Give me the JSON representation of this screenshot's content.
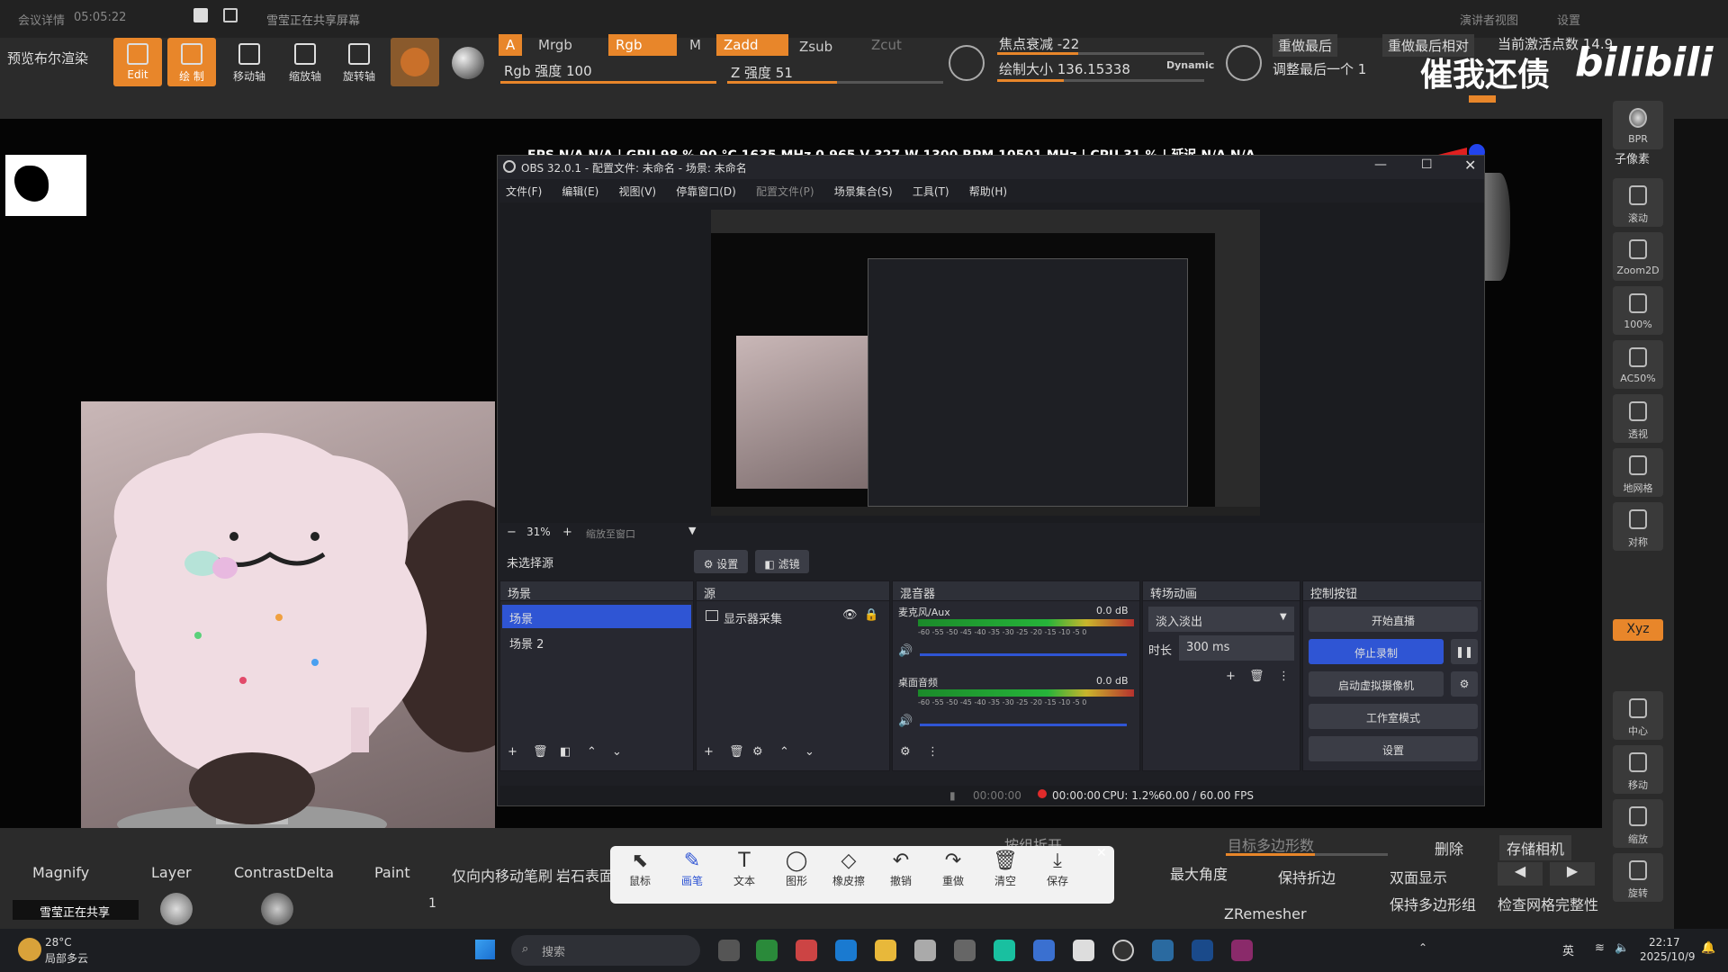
{
  "meeting": {
    "title": "会议详情",
    "time": "05:05:22",
    "sharing": "雪莹正在共享屏幕"
  },
  "meeting_right": {
    "presenter": "演讲者视图",
    "settings": "设置"
  },
  "zbrush": {
    "left_label": "预览布尔渲染",
    "tools": [
      "Edit",
      "绘 制",
      "移动轴",
      "缩放轴",
      "旋转轴"
    ],
    "channels": [
      "A",
      "Mrgb",
      "Rgb",
      "M",
      "Zadd",
      "Zsub",
      "Zcut"
    ],
    "rgb_intensity": "Rgb 强度 100",
    "z_intensity": "Z 强度 51",
    "focal": "焦点衰减 -22",
    "draw_size": "绘制大小 136.15338",
    "dynamic": "Dynamic",
    "redo_last": "重做最后",
    "redo_relative": "重做最后相对",
    "adjust_last": "调整最后一个 1",
    "active_points": "当前激活点数 14.9",
    "watermark": "催我还债",
    "right_tray": [
      "BPR",
      "子像素",
      "滚动",
      "Zoom2D",
      "100%",
      "AC50%",
      "透视",
      "地网格",
      "对称",
      "Xyz",
      "中心",
      "移动",
      "缩放",
      "旋转"
    ],
    "bottom_brushes": [
      "Magnify",
      "Layer",
      "ContrastDelta",
      "Paint",
      "仅向内移动笔刷",
      "岩石表面"
    ],
    "bottom_count": "1",
    "bottom_right": {
      "keep_creases": "保持折边",
      "double_sided": "双面显示",
      "keep_groups": "保持多边形组",
      "check_mesh": "检查网格完整性",
      "delete": "删除",
      "store_camera": "存储相机",
      "target_polys": "目标多边形数",
      "max_angle": "最大角度",
      "zremesher": "ZRemesher",
      "subdivide": "按组拆开"
    },
    "sharing_badge": "雪莹正在共享"
  },
  "stats": {
    "fps_label": "FPS",
    "fps": "N/A",
    "fps2": "N/A",
    "gpu_label": "GPU",
    "gpu": "98 % 90 °C 1635 MHz 0.965 V 327 W 1300 RPM 10501 MHz",
    "cpu_label": "CPU",
    "cpu": "31 %",
    "lat_label": "延迟",
    "lat": "N/A",
    "lat2": "N/A"
  },
  "obs": {
    "title": "OBS 32.0.1 - 配置文件: 未命名 - 场景: 未命名",
    "menu": [
      "文件(F)",
      "编辑(E)",
      "视图(V)",
      "停靠窗口(D)",
      "配置文件(P)",
      "场景集合(S)",
      "工具(T)",
      "帮助(H)"
    ],
    "zoom": "31%",
    "zoom_mode": "缩放至窗口",
    "no_source": "未选择源",
    "settings_btn": "设置",
    "filters_btn": "滤镜",
    "scenes_title": "场景",
    "scenes": [
      "场景",
      "场景 2"
    ],
    "sources_title": "源",
    "sources": [
      "显示器采集"
    ],
    "mixer_title": "混音器",
    "mixer": [
      {
        "name": "麦克风/Aux",
        "db": "0.0 dB"
      },
      {
        "name": "桌面音频",
        "db": "0.0 dB"
      }
    ],
    "meter_ticks": "-60 -55 -50 -45 -40 -35 -30 -25 -20 -15 -10 -5 0",
    "trans_title": "转场动画",
    "transition": "淡入淡出",
    "duration_label": "时长",
    "duration": "300 ms",
    "ctrl_title": "控制按钮",
    "controls": [
      "开始直播",
      "停止录制",
      "启动虚拟摄像机",
      "工作室模式",
      "设置"
    ],
    "status": {
      "stream_time": "00:00:00",
      "rec_time": "00:00:00",
      "cpu": "CPU: 1.2%",
      "fps": "60.00 / 60.00 FPS"
    }
  },
  "paint": [
    "鼠标",
    "画笔",
    "文本",
    "图形",
    "橡皮擦",
    "撤销",
    "重做",
    "清空",
    "保存"
  ],
  "taskbar": {
    "weather_temp": "28°C",
    "weather_desc": "局部多云",
    "search": "搜索",
    "ime": "英",
    "time": "22:17",
    "date": "2025/10/9"
  },
  "colors": {
    "accent": "#e8862a",
    "obs_blue": "#2f55d4",
    "rec_red": "#e02b2b"
  }
}
